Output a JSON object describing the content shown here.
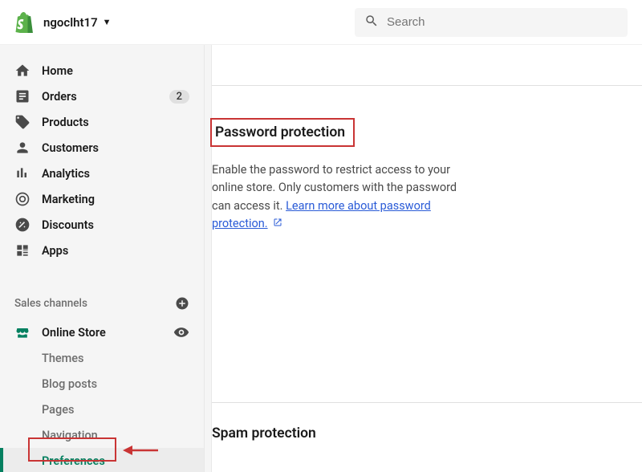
{
  "header": {
    "store_name": "ngoclht17",
    "search_placeholder": "Search"
  },
  "sidebar": {
    "items": [
      {
        "label": "Home"
      },
      {
        "label": "Orders",
        "badge": "2"
      },
      {
        "label": "Products"
      },
      {
        "label": "Customers"
      },
      {
        "label": "Analytics"
      },
      {
        "label": "Marketing"
      },
      {
        "label": "Discounts"
      },
      {
        "label": "Apps"
      }
    ],
    "section_label": "Sales channels",
    "channel": {
      "label": "Online Store"
    },
    "sub": [
      {
        "label": "Themes"
      },
      {
        "label": "Blog posts"
      },
      {
        "label": "Pages"
      },
      {
        "label": "Navigation"
      },
      {
        "label": "Preferences"
      }
    ]
  },
  "main": {
    "password": {
      "title": "Password protection",
      "body_prefix": "Enable the password to restrict access to your online store. Only customers with the password can access it. ",
      "link": "Learn more about password protection."
    },
    "spam": {
      "title": "Spam protection"
    }
  }
}
